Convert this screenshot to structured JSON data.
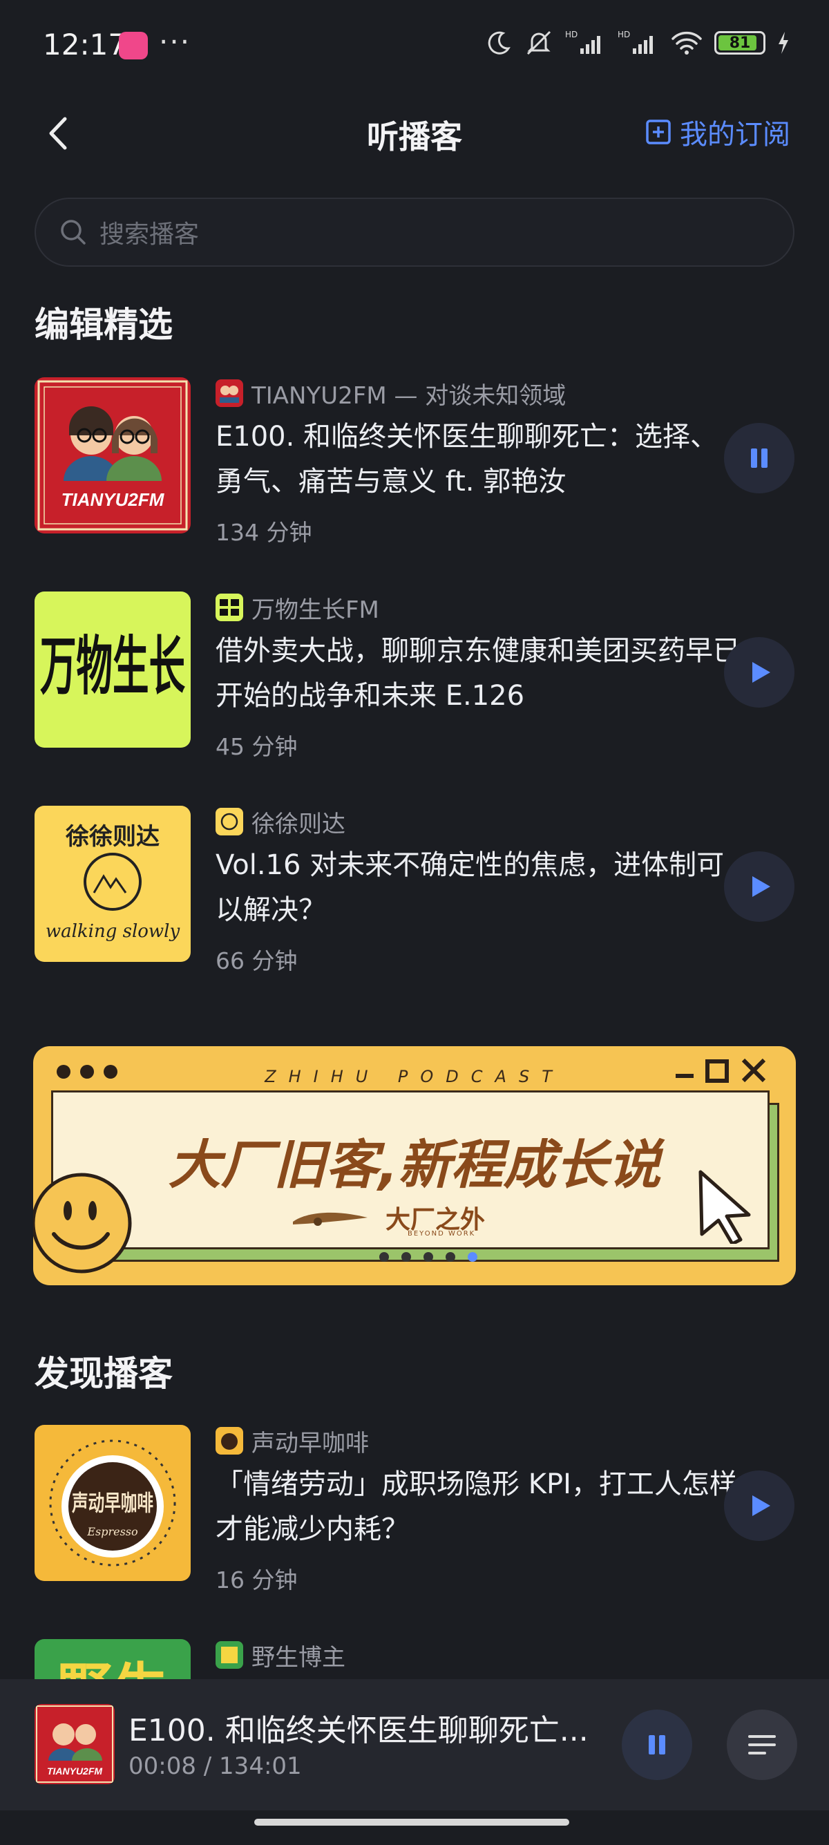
{
  "status_bar": {
    "time": "12:17",
    "dots": "···",
    "battery": "81",
    "icons": [
      "moon-icon",
      "mute-icon",
      "hd-signal-icon",
      "hd-signal-icon",
      "wifi-icon",
      "battery-icon",
      "charging-icon"
    ]
  },
  "nav": {
    "title": "听播客",
    "subscribe_label": "我的订阅"
  },
  "search": {
    "placeholder": "搜索播客"
  },
  "editor_picks": {
    "title": "编辑精选",
    "items": [
      {
        "podcast": "TIANYU2FM — 对谈未知领域",
        "title": "E100. 和临终关怀医生聊聊死亡：选择、勇气、痛苦与意义 ft. 郭艳汝",
        "duration": "134 分钟",
        "state": "playing",
        "cover_text": "TIANYU2FM"
      },
      {
        "podcast": "万物生长FM",
        "title": "借外卖大战，聊聊京东健康和美团买药早已开始的战争和未来 E.126",
        "duration": "45 分钟",
        "state": "paused",
        "cover_text": "万物生长"
      },
      {
        "podcast": "徐徐则达",
        "title": "Vol.16 对未来不确定性的焦虑，进体制可以解决？",
        "duration": "66 分钟",
        "state": "paused",
        "cover_text": "徐徐则达",
        "cover_subtext": "walking slowly"
      }
    ]
  },
  "banner": {
    "tag": "ZHIHU PODCAST",
    "headline": "大厂旧客,新程成长说",
    "brand": "大厂之外",
    "brand_sub": "BEYOND WORK",
    "slide_count": 5,
    "active_slide": 5
  },
  "discover": {
    "title": "发现播客",
    "items": [
      {
        "podcast": "声动早咖啡",
        "title": "「情绪劳动」成职场隐形 KPI，打工人怎样才能减少内耗？",
        "duration": "16 分钟",
        "cover_text": "声动早咖啡",
        "cover_subtext": "Espresso"
      },
      {
        "podcast": "野生博主",
        "cover_text": "野生"
      }
    ]
  },
  "player": {
    "title": "E100. 和临终关怀医生聊聊死亡...",
    "time": "00:08 / 134:01",
    "cover_text": "TIANYU2FM"
  },
  "colors": {
    "background": "#1b1d22",
    "accent": "#5b8cff",
    "play_button_bg": "#262a39",
    "banner_yellow": "#f6c453"
  }
}
